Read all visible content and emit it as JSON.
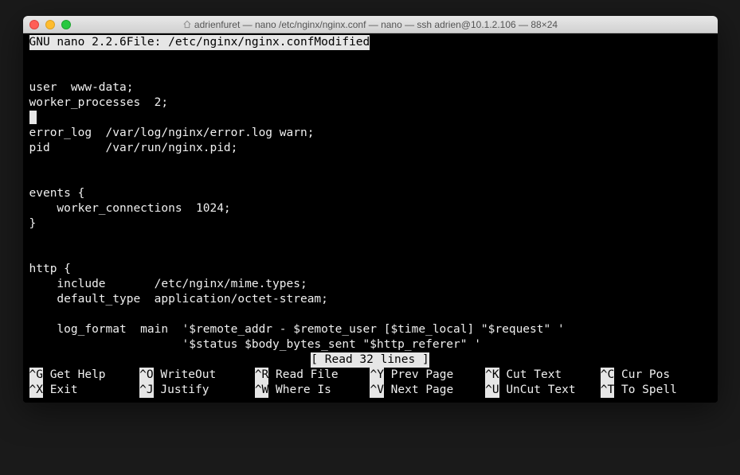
{
  "window": {
    "title": "adrienfuret — nano /etc/nginx/nginx.conf — nano — ssh adrien@10.1.2.106 — 88×24"
  },
  "topbar": {
    "left": "  GNU nano 2.2.6            ",
    "center": "  File: /etc/nginx/nginx.conf                     ",
    "right": "Modified  "
  },
  "content": {
    "l01": "",
    "l02": "",
    "l03": "user  www-data;",
    "l04": "worker_processes  2;",
    "l05_cursor": " ",
    "l06": "error_log  /var/log/nginx/error.log warn;",
    "l07": "pid        /var/run/nginx.pid;",
    "l08": "",
    "l09": "",
    "l10": "events {",
    "l11": "    worker_connections  1024;",
    "l12": "}",
    "l13": "",
    "l14": "",
    "l15": "http {",
    "l16": "    include       /etc/nginx/mime.types;",
    "l17": "    default_type  application/octet-stream;",
    "l18": "",
    "l19": "    log_format  main  '$remote_addr - $remote_user [$time_local] \"$request\" '",
    "l20": "                      '$status $body_bytes_sent \"$http_referer\" '"
  },
  "status": {
    "text": "[ Read 32 lines ]"
  },
  "commands": {
    "row1": [
      {
        "key": "^G",
        "label": " Get Help"
      },
      {
        "key": "^O",
        "label": " WriteOut"
      },
      {
        "key": "^R",
        "label": " Read File"
      },
      {
        "key": "^Y",
        "label": " Prev Page"
      },
      {
        "key": "^K",
        "label": " Cut Text"
      },
      {
        "key": "^C",
        "label": " Cur Pos"
      }
    ],
    "row2": [
      {
        "key": "^X",
        "label": " Exit"
      },
      {
        "key": "^J",
        "label": " Justify"
      },
      {
        "key": "^W",
        "label": " Where Is"
      },
      {
        "key": "^V",
        "label": " Next Page"
      },
      {
        "key": "^U",
        "label": " UnCut Text"
      },
      {
        "key": "^T",
        "label": " To Spell"
      }
    ]
  }
}
